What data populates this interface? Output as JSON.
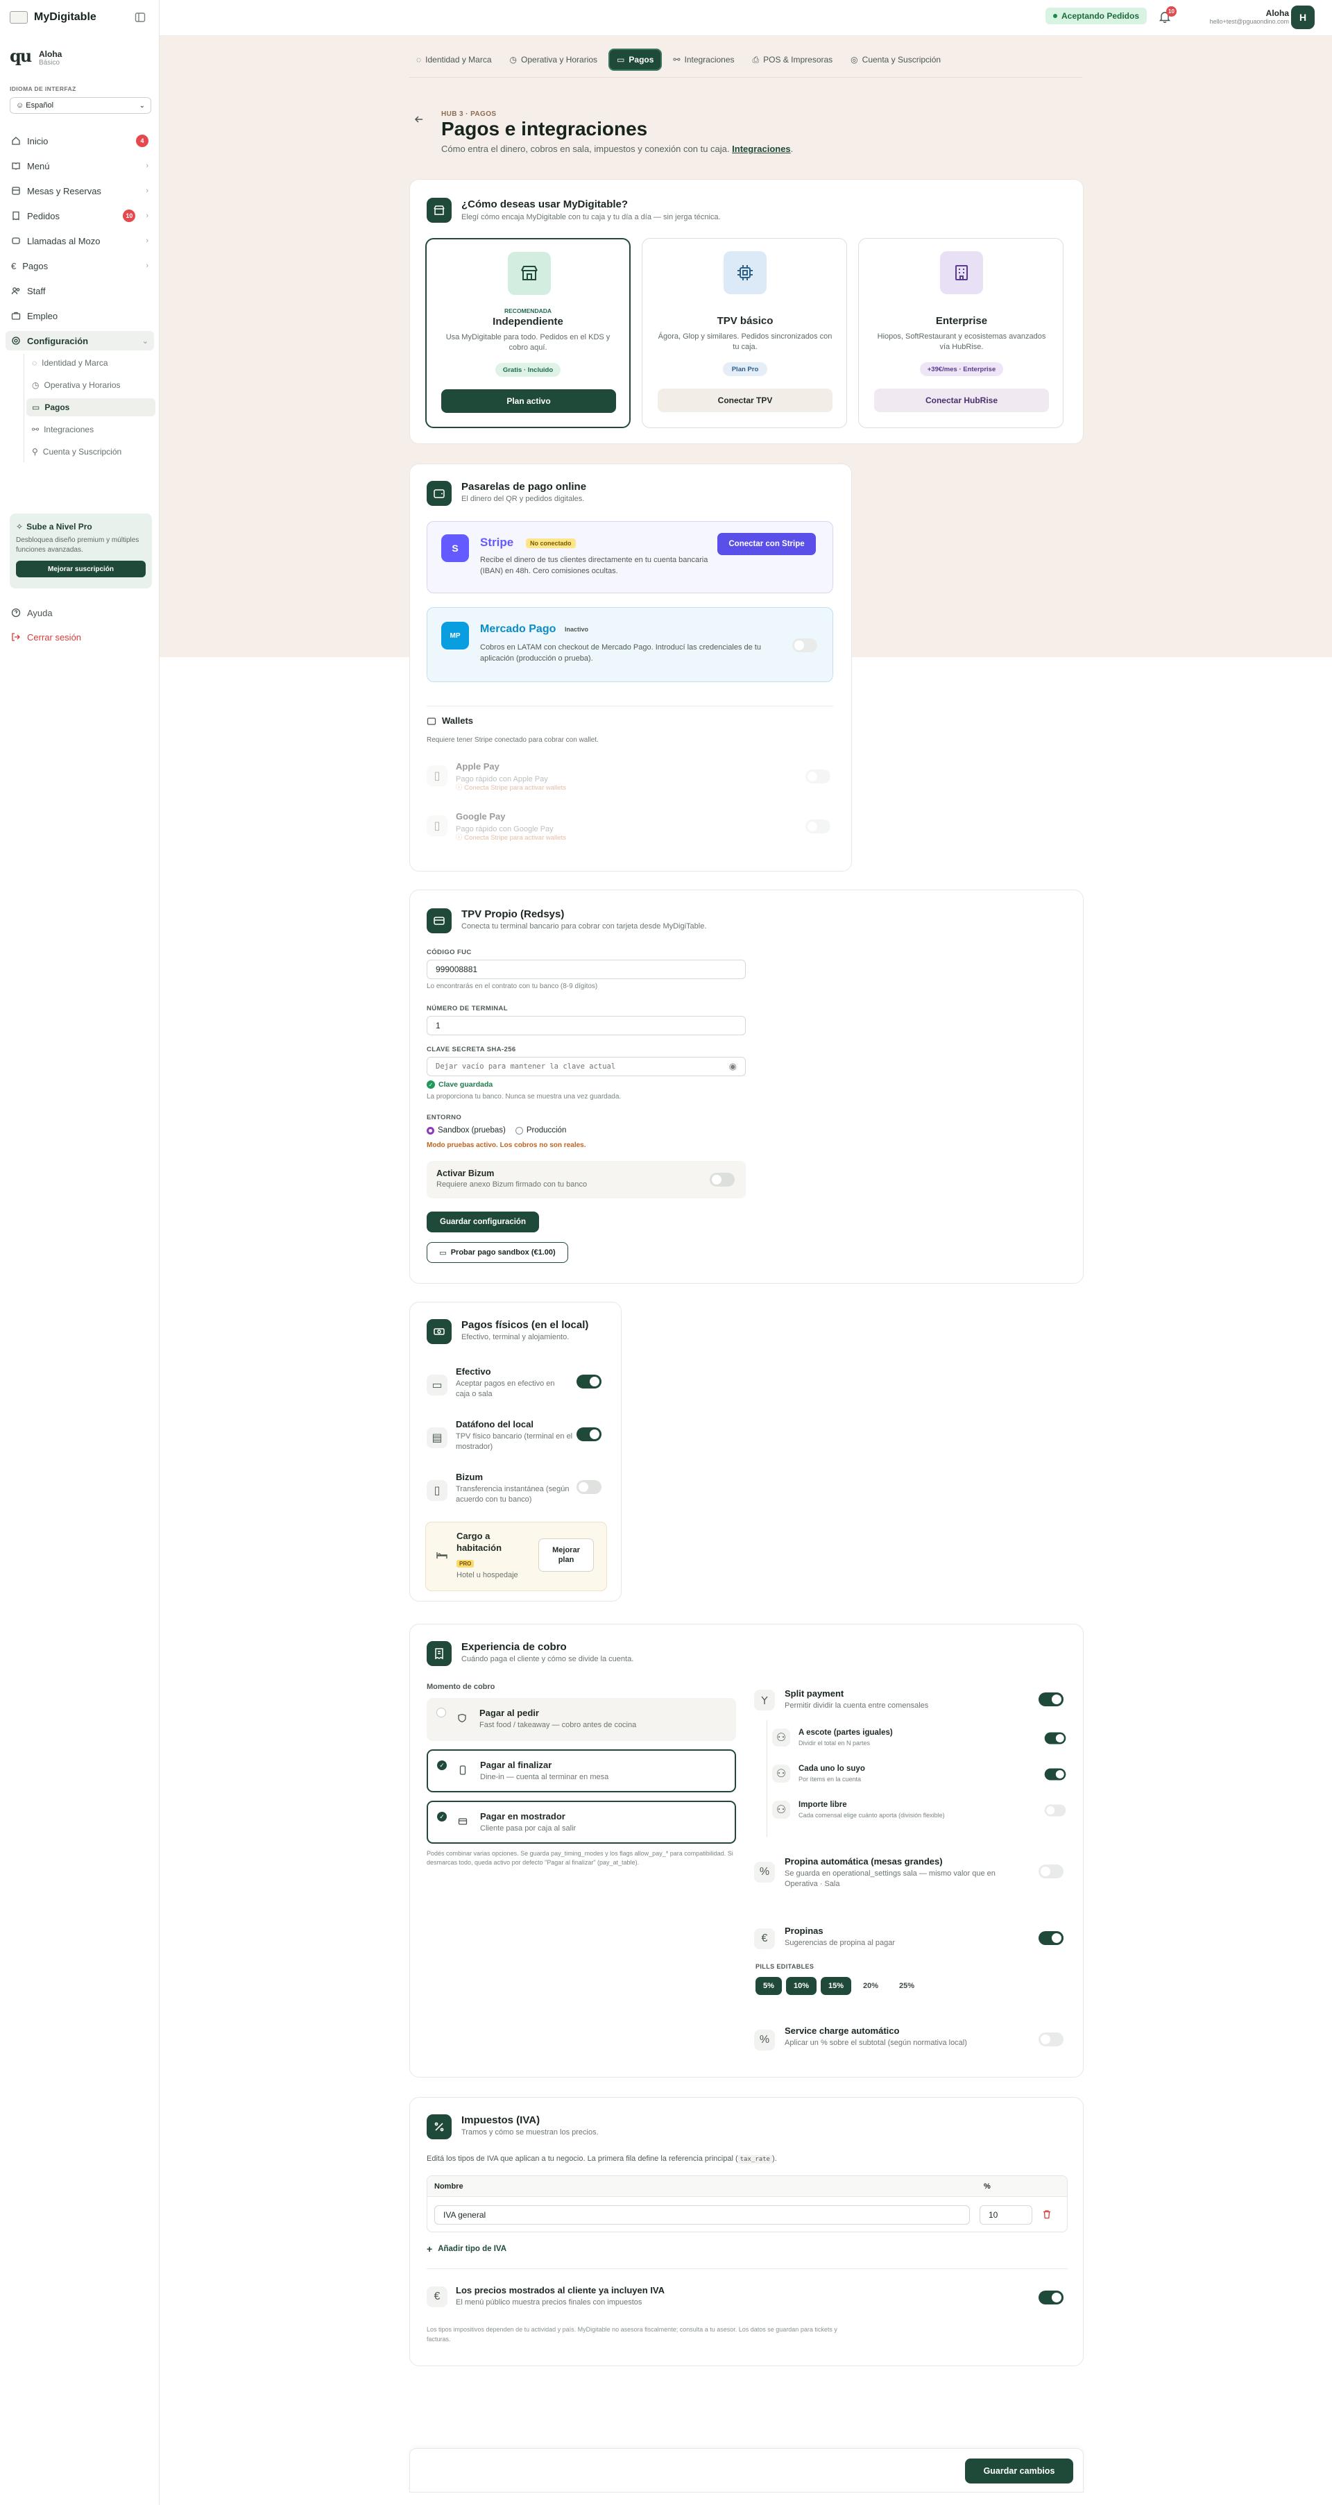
{
  "app": {
    "name": "MyDigitable"
  },
  "sidebar": {
    "restaurant": {
      "logo": "qu",
      "name": "Aloha",
      "plan": "Básico"
    },
    "language_label": "IDIOMA DE INTERFAZ",
    "language_value": "☺ Español",
    "items": [
      {
        "label": "Inicio",
        "badge": "4"
      },
      {
        "label": "Menú"
      },
      {
        "label": "Mesas y Reservas"
      },
      {
        "label": "Pedidos",
        "badge": "10"
      },
      {
        "label": "Llamadas al Mozo"
      },
      {
        "label": "Pagos"
      },
      {
        "label": "Staff"
      },
      {
        "label": "Empleo"
      },
      {
        "label": "Configuración"
      }
    ],
    "subitems": [
      "Identidad y Marca",
      "Operativa y Horarios",
      "Pagos",
      "Integraciones",
      "Cuenta y Suscripción"
    ],
    "promo": {
      "title": "Sube a Nivel Pro",
      "desc": "Desbloquea diseño premium y múltiples funciones avanzadas.",
      "button": "Mejorar suscripción"
    },
    "help": "Ayuda",
    "logout": "Cerrar sesión"
  },
  "topbar": {
    "status": "Aceptando Pedidos",
    "notifications": "10",
    "user_name": "Aloha",
    "user_email": "hello+test@pguaondino.com",
    "avatar": "H"
  },
  "tabs": [
    "Identidad y Marca",
    "Operativa y Horarios",
    "Pagos",
    "Integraciones",
    "POS & Impresoras",
    "Cuenta y Suscripción"
  ],
  "page": {
    "crumb": "HUB 3 · PAGOS",
    "title": "Pagos e integraciones",
    "subtitle": "Cómo entra el dinero, cobros en sala, impuestos y conexión con tu caja.",
    "subtitle_link": "Integraciones"
  },
  "usage": {
    "title": "¿Cómo deseas usar MyDigitable?",
    "subtitle": "Elegí cómo encaja MyDigitable con tu caja y tu día a día — sin jerga técnica.",
    "options": [
      {
        "tag": "RECOMENDADA",
        "name": "Independiente",
        "desc": "Usa MyDigitable para todo. Pedidos en el KDS y cobro aquí.",
        "badge": "Gratis · Incluido",
        "button": "Plan activo"
      },
      {
        "name": "TPV básico",
        "desc": "Ágora, Glop y similares. Pedidos sincronizados con tu caja.",
        "badge": "Plan Pro",
        "button": "Conectar TPV"
      },
      {
        "name": "Enterprise",
        "desc": "Hiopos, SoftRestaurant y ecosistemas avanzados vía HubRise.",
        "badge": "+39€/mes · Enterprise",
        "button": "Conectar HubRise"
      }
    ]
  },
  "gateways": {
    "title": "Pasarelas de pago online",
    "subtitle": "El dinero del QR y pedidos digitales.",
    "stripe": {
      "logo": "S",
      "name": "Stripe",
      "status": "No conectado",
      "desc": "Recibe el dinero de tus clientes directamente en tu cuenta bancaria (IBAN) en 48h. Cero comisiones ocultas.",
      "button": "Conectar con Stripe"
    },
    "mercadopago": {
      "logo": "MP",
      "name": "Mercado Pago",
      "status": "Inactivo",
      "desc": "Cobros en LATAM con checkout de Mercado Pago. Introducí las credenciales de tu aplicación (producción o prueba)."
    },
    "wallets": {
      "title": "Wallets",
      "subtitle": "Requiere tener Stripe conectado para cobrar con wallet.",
      "items": [
        {
          "name": "Apple Pay",
          "desc": "Pago rápido con Apple Pay",
          "note": "Conecta Stripe para activar wallets"
        },
        {
          "name": "Google Pay",
          "desc": "Pago rápido con Google Pay",
          "note": "Conecta Stripe para activar wallets"
        }
      ]
    }
  },
  "tpv": {
    "title": "TPV Propio (Redsys)",
    "subtitle": "Conecta tu terminal bancario para cobrar con tarjeta desde MyDigiTable.",
    "fuc_label": "CÓDIGO FUC",
    "fuc_value": "999008881",
    "fuc_hint": "Lo encontrarás en el contrato con tu banco (8-9 dígitos)",
    "terminal_label": "NÚMERO DE TERMINAL",
    "terminal_value": "1",
    "key_label": "CLAVE SECRETA SHA-256",
    "key_placeholder": "Dejar vacío para mantener la clave actual",
    "key_saved": "Clave guardada",
    "key_hint": "La proporciona tu banco. Nunca se muestra una vez guardada.",
    "env_label": "ENTORNO",
    "env_sandbox": "Sandbox (pruebas)",
    "env_prod": "Producción",
    "env_warning": "Modo pruebas activo. Los cobros no son reales.",
    "bizum_title": "Activar Bizum",
    "bizum_sub": "Requiere anexo Bizum firmado con tu banco",
    "save_button": "Guardar configuración",
    "test_button": "Probar pago sandbox (€1.00)"
  },
  "physical": {
    "title": "Pagos físicos (en el local)",
    "subtitle": "Efectivo, terminal y alojamiento.",
    "items": [
      {
        "title": "Efectivo",
        "desc": "Aceptar pagos en efectivo en caja o sala"
      },
      {
        "title": "Datáfono del local",
        "desc": "TPV físico bancario (terminal en el mostrador)"
      },
      {
        "title": "Bizum",
        "desc": "Transferencia instantánea (según acuerdo con tu banco)"
      }
    ],
    "room": {
      "title": "Cargo a habitación",
      "tag": "PRO",
      "desc": "Hotel u hospedaje",
      "button": "Mejorar plan"
    }
  },
  "checkout": {
    "title": "Experiencia de cobro",
    "subtitle": "Cuándo paga el cliente y cómo se divide la cuenta.",
    "moment_label": "Momento de cobro",
    "moments": [
      {
        "title": "Pagar al pedir",
        "desc": "Fast food / takeaway — cobro antes de cocina"
      },
      {
        "title": "Pagar al finalizar",
        "desc": "Dine-in — cuenta al terminar en mesa"
      },
      {
        "title": "Pagar en mostrador",
        "desc": "Cliente pasa por caja al salir"
      }
    ],
    "moments_note": "Podés combinar varias opciones. Se guarda pay_timing_modes y los flags allow_pay_* para compatibilidad. Si desmarcas todo, queda activo por defecto \"Pagar al finalizar\" (pay_at_table).",
    "split": {
      "title": "Split payment",
      "desc": "Permitir dividir la cuenta entre comensales",
      "options": [
        {
          "title": "A escote (partes iguales)",
          "desc": "Dividir el total en N partes"
        },
        {
          "title": "Cada uno lo suyo",
          "desc": "Por ítems en la cuenta"
        },
        {
          "title": "Importe libre",
          "desc": "Cada comensal elige cuánto aporta (división flexible)"
        }
      ]
    },
    "auto_tip": {
      "title": "Propina automática (mesas grandes)",
      "desc": "Se guarda en operational_settings sala — mismo valor que en Operativa · Sala"
    },
    "tips": {
      "title": "Propinas",
      "desc": "Sugerencias de propina al pagar",
      "pills_label": "PILLS EDITABLES",
      "pills": [
        "5%",
        "10%",
        "15%",
        "20%",
        "25%"
      ]
    },
    "service": {
      "title": "Service charge automático",
      "desc": "Aplicar un % sobre el subtotal (según normativa local)"
    }
  },
  "tax": {
    "title": "Impuestos (IVA)",
    "subtitle": "Tramos y cómo se muestran los precios.",
    "intro": "Editá los tipos de IVA que aplican a tu negocio. La primera fila define la referencia principal (",
    "intro_code": "tax_rate",
    "intro_end": ").",
    "col_name": "Nombre",
    "col_pct": "%",
    "rows": [
      {
        "name": "IVA general",
        "pct": "10"
      }
    ],
    "add": "Añadir tipo de IVA",
    "incl_title": "Los precios mostrados al cliente ya incluyen IVA",
    "incl_desc": "El menú público muestra precios finales con impuestos",
    "footer": "Los tipos impositivos dependen de tu actividad y país. MyDigitable no asesora fiscalmente; consulta a tu asesor. Los datos se guardan para tickets y facturas."
  },
  "footer": {
    "save": "Guardar cambios"
  }
}
